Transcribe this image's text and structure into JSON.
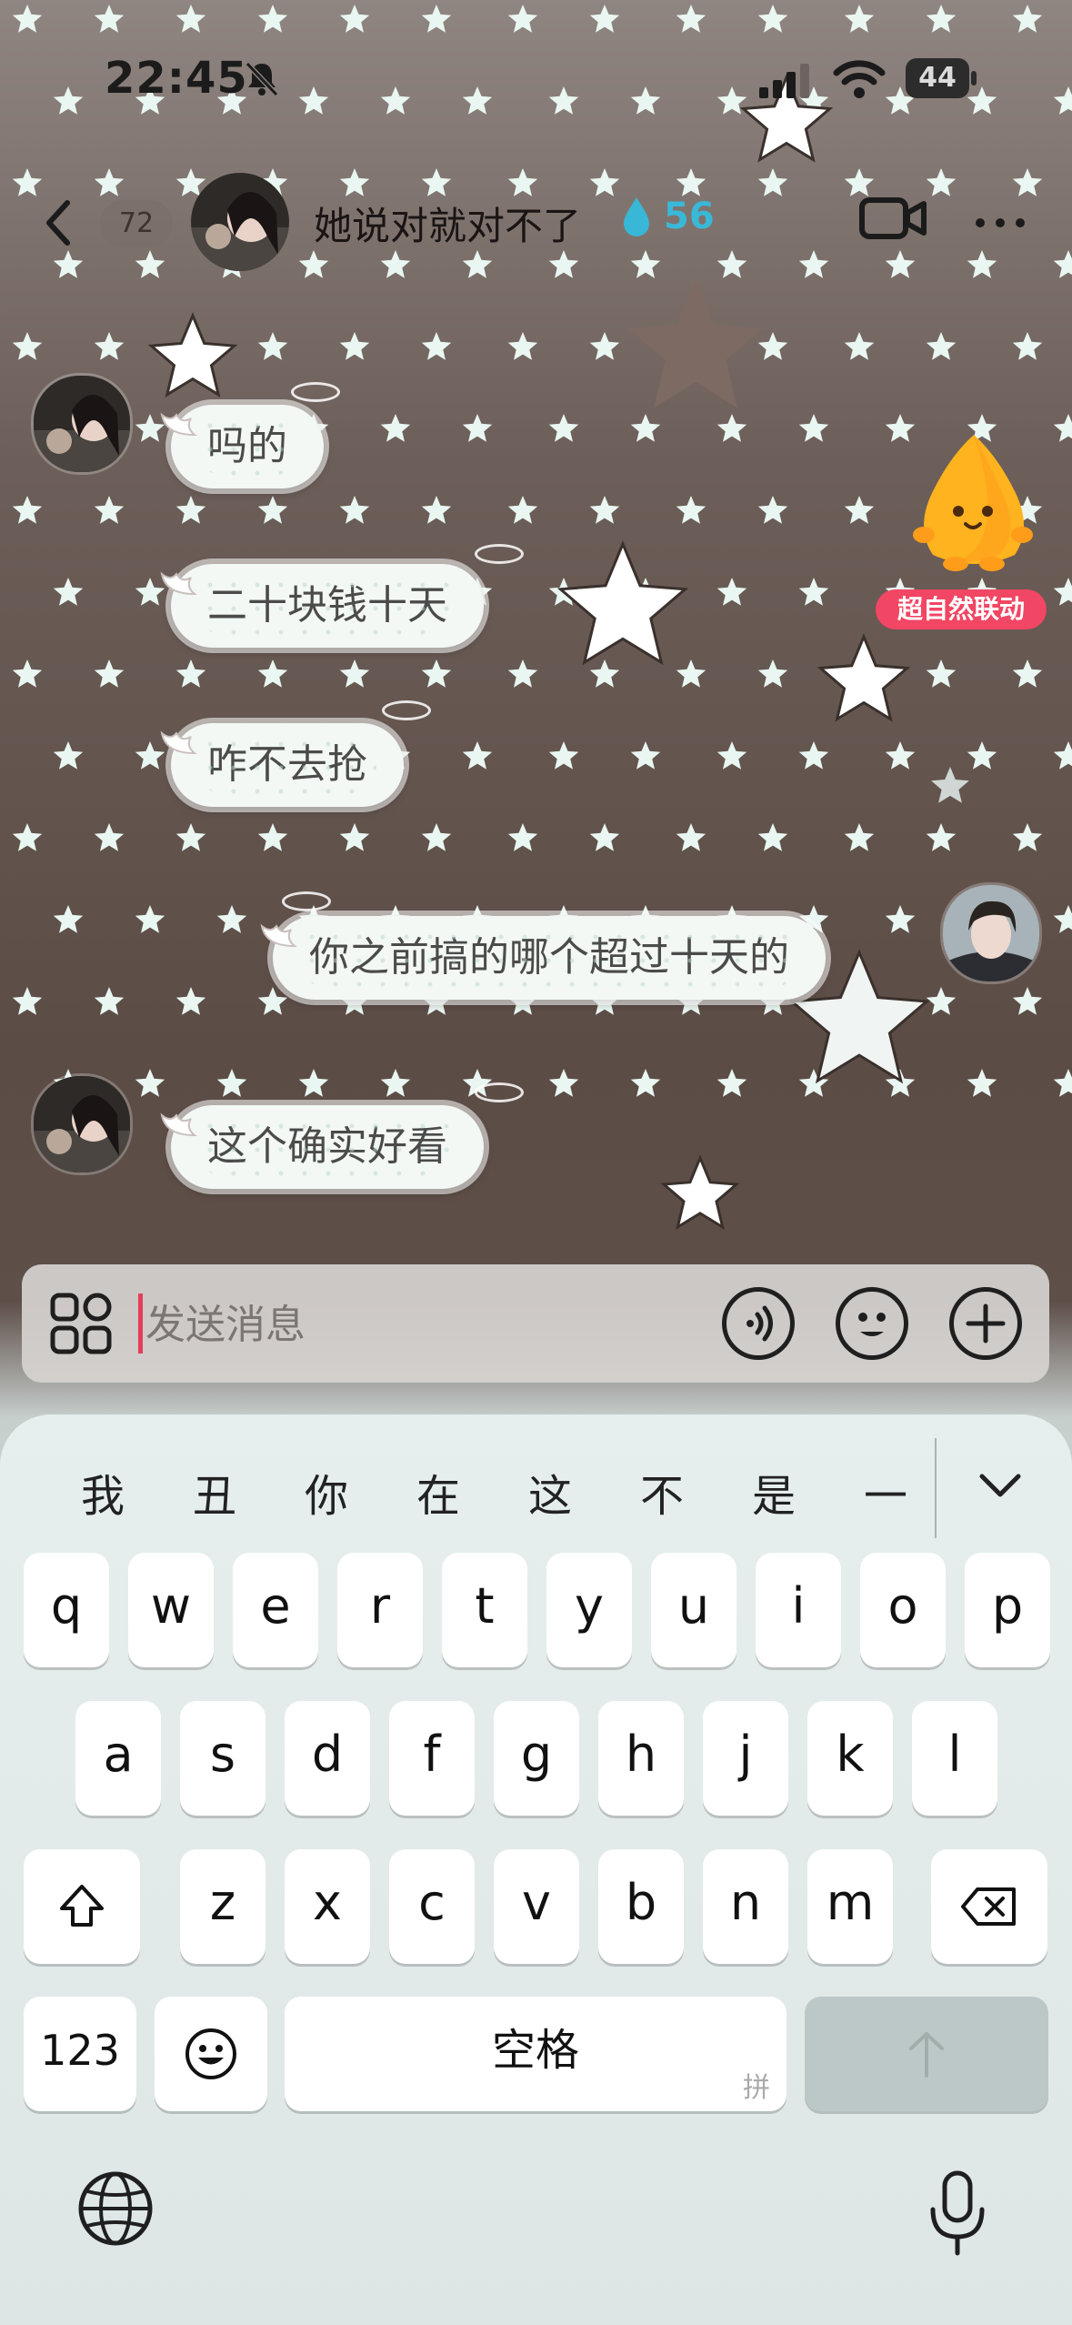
{
  "status_bar": {
    "time": "22:45",
    "battery": "44"
  },
  "nav": {
    "unread_count": "72",
    "title": "她说对就对不了",
    "streak": "56"
  },
  "messages": [
    {
      "side": "left",
      "text": "吗的"
    },
    {
      "side": "left",
      "text": "二十块钱十天"
    },
    {
      "side": "left",
      "text": "咋不去抢"
    },
    {
      "side": "right",
      "text": "你之前搞的哪个超过十天的"
    },
    {
      "side": "left",
      "text": "这个确实好看"
    }
  ],
  "mascot": {
    "label": "超自然联动"
  },
  "input": {
    "placeholder": "发送消息"
  },
  "keyboard": {
    "candidates": [
      "我",
      "丑",
      "你",
      "在",
      "这",
      "不",
      "是",
      "一"
    ],
    "row1": [
      "q",
      "w",
      "e",
      "r",
      "t",
      "y",
      "u",
      "i",
      "o",
      "p"
    ],
    "row2": [
      "a",
      "s",
      "d",
      "f",
      "g",
      "h",
      "j",
      "k",
      "l"
    ],
    "row3": [
      "z",
      "x",
      "c",
      "v",
      "b",
      "n",
      "m"
    ],
    "numbers_key": "123",
    "space_key": "空格",
    "space_hint": "拼"
  },
  "icons": [
    "bell-mute-icon",
    "signal-icon",
    "wifi-icon",
    "back-icon",
    "water-drop-icon",
    "video-call-icon",
    "more-icon",
    "apps-grid-icon",
    "voice-icon",
    "emoji-icon",
    "plus-icon",
    "shift-icon",
    "backspace-icon",
    "globe-icon",
    "mic-icon",
    "return-arrow-icon"
  ]
}
